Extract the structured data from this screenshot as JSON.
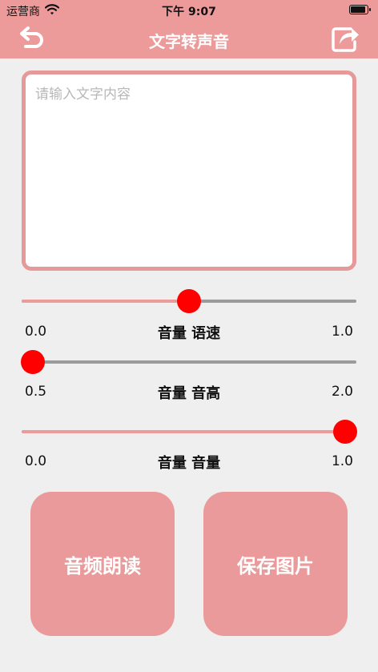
{
  "status_bar": {
    "carrier": "运营商",
    "time": "下午 9:07"
  },
  "nav": {
    "title": "文字转声音",
    "back_icon": "back-arrow-icon",
    "share_icon": "share-icon"
  },
  "text_input": {
    "placeholder": "请输入文字内容",
    "value": ""
  },
  "sliders": [
    {
      "label": "音量 语速",
      "min": "0.0",
      "max": "1.0",
      "value_fraction": 0.5
    },
    {
      "label": "音量 音高",
      "min": "0.5",
      "max": "2.0",
      "value_fraction": 0.0
    },
    {
      "label": "音量 音量",
      "min": "0.0",
      "max": "1.0",
      "value_fraction": 1.0
    }
  ],
  "buttons": {
    "read_aloud": "音频朗读",
    "save_image": "保存图片"
  },
  "colors": {
    "accent": "#ec9a9a",
    "thumb": "#ff0000",
    "track": "#9b9b9b",
    "background": "#efefef"
  }
}
